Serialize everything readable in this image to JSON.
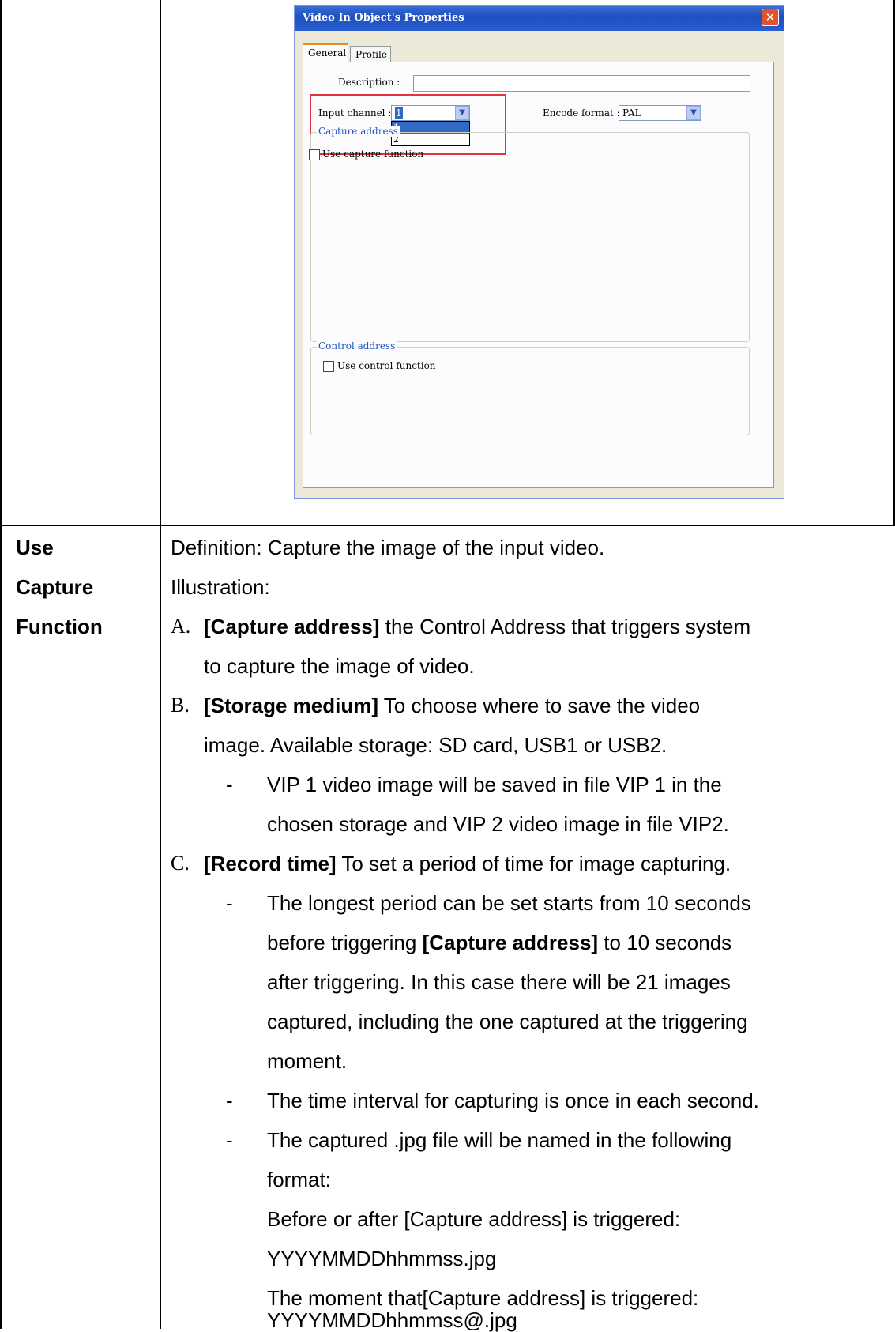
{
  "dialog": {
    "title": "Video In Object's Properties",
    "close_glyph": "✕",
    "tabs": [
      "General",
      "Profile"
    ],
    "description_label": "Description :",
    "description_value": "",
    "input_channel_label": "Input channel :",
    "input_channel_value": "1",
    "input_channel_options": [
      "1",
      "2"
    ],
    "encode_format_label": "Encode format :",
    "encode_format_value": "PAL",
    "capture_group_label": "Capture address",
    "use_capture_label": "Use capture function",
    "control_group_label": "Control address",
    "use_control_label": "Use control function",
    "dropdown_glyph": "▼"
  },
  "section": {
    "heading": [
      "Use",
      "Capture",
      "Function"
    ],
    "definition": "Definition: Capture the image of the input video.",
    "illustration": "Illustration:",
    "items": [
      {
        "marker": "A.",
        "term": "[Capture address]",
        "lines": [
          " the Control Address that triggers system",
          "to capture the image of video."
        ]
      },
      {
        "marker": "B.",
        "term": "[Storage medium]",
        "lines": [
          " To choose where to save the video",
          "image. Available storage: SD card, USB1 or USB2."
        ],
        "bullets": [
          [
            "VIP 1 video image will be saved in file VIP 1 in the",
            "chosen storage and VIP 2 video image in file VIP2."
          ]
        ]
      },
      {
        "marker": "C.",
        "term": "[Record time]",
        "lines": [
          " To set a period of time for image capturing."
        ],
        "bullets": [
          [
            "The longest period can be set starts from 10 seconds",
            "before triggering ",
            "[Capture address]",
            " to 10 seconds",
            "after triggering. In this case there will be 21 images",
            "captured, including the one captured at the triggering",
            "moment."
          ],
          [
            "The time interval for capturing is once in each second."
          ],
          [
            "The captured .jpg file will be named in the following",
            "format:",
            "Before or after [Capture address] is triggered:",
            "YYYYMMDDhhmmss.jpg",
            "The moment that[Capture address] is triggered:",
            "YYYYMMDDhhmmss@.jpg"
          ]
        ]
      }
    ],
    "bullet_glyph": "-"
  }
}
